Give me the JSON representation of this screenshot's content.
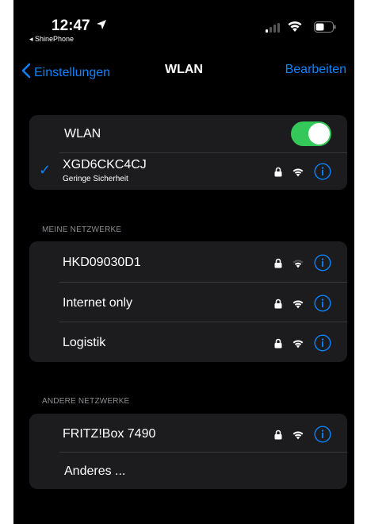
{
  "status_bar": {
    "time": "12:47",
    "back_app": "◂ ShinePhone"
  },
  "navbar": {
    "back_label": "Einstellungen",
    "title": "WLAN",
    "edit_label": "Bearbeiten"
  },
  "wlan_group": {
    "toggle_label": "WLAN",
    "toggle_on": true,
    "connected_network": {
      "name": "XGD6CKC4CJ",
      "subtitle": "Geringe Sicherheit",
      "checkmark": "✓"
    }
  },
  "my_networks": {
    "header": "MEINE NETZWERKE",
    "items": [
      {
        "name": "HKD09030D1"
      },
      {
        "name": "Internet only"
      },
      {
        "name": "Logistik"
      }
    ]
  },
  "other_networks": {
    "header": "ANDERE NETZWERKE",
    "items": [
      {
        "name": "FRITZ!Box 7490"
      }
    ],
    "other_label": "Anderes ..."
  },
  "colors": {
    "accent": "#0a84ff",
    "toggle_on": "#34c759",
    "group_bg": "#1c1c1e",
    "background": "#000000"
  },
  "icons": {
    "lock": "lock-icon",
    "wifi": "wifi-icon",
    "info": "info-icon"
  }
}
